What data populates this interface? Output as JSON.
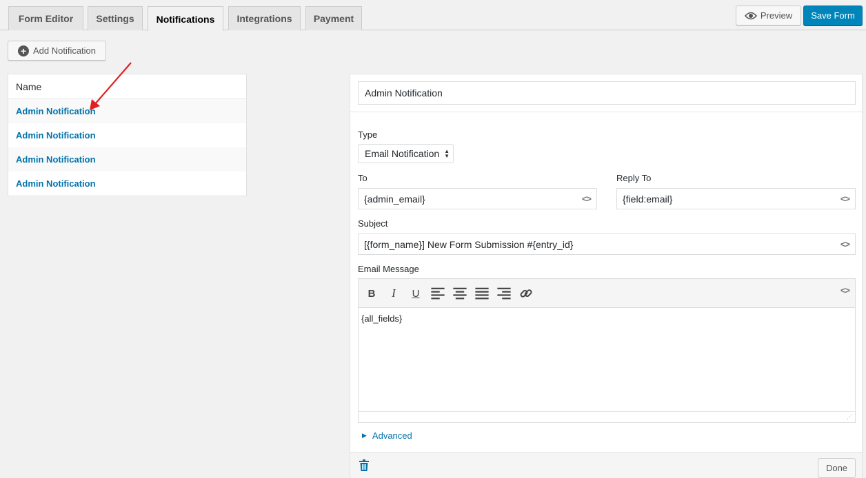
{
  "tabs": [
    {
      "label": "Form Editor",
      "active": false
    },
    {
      "label": "Settings",
      "active": false
    },
    {
      "label": "Notifications",
      "active": true
    },
    {
      "label": "Integrations",
      "active": false
    },
    {
      "label": "Payment",
      "active": false
    }
  ],
  "header": {
    "preview_label": "Preview",
    "save_label": "Save Form"
  },
  "sidebar": {
    "add_label": "Add Notification",
    "column_header": "Name",
    "items": [
      "Admin Notification",
      "Admin Notification",
      "Admin Notification",
      "Admin Notification"
    ]
  },
  "editor": {
    "name_value": "Admin Notification",
    "type_label": "Type",
    "type_value": "Email Notification",
    "to_label": "To",
    "to_value": "{admin_email}",
    "reply_to_label": "Reply To",
    "reply_to_value": "{field:email}",
    "subject_label": "Subject",
    "subject_value": "[{form_name}] New Form Submission #{entry_id}",
    "message_label": "Email Message",
    "message_value": "{all_fields}",
    "advanced_label": "Advanced",
    "done_label": "Done"
  },
  "colors": {
    "accent": "#0073aa",
    "primary_button": "#0085ba",
    "annotation_arrow": "#e02020"
  }
}
